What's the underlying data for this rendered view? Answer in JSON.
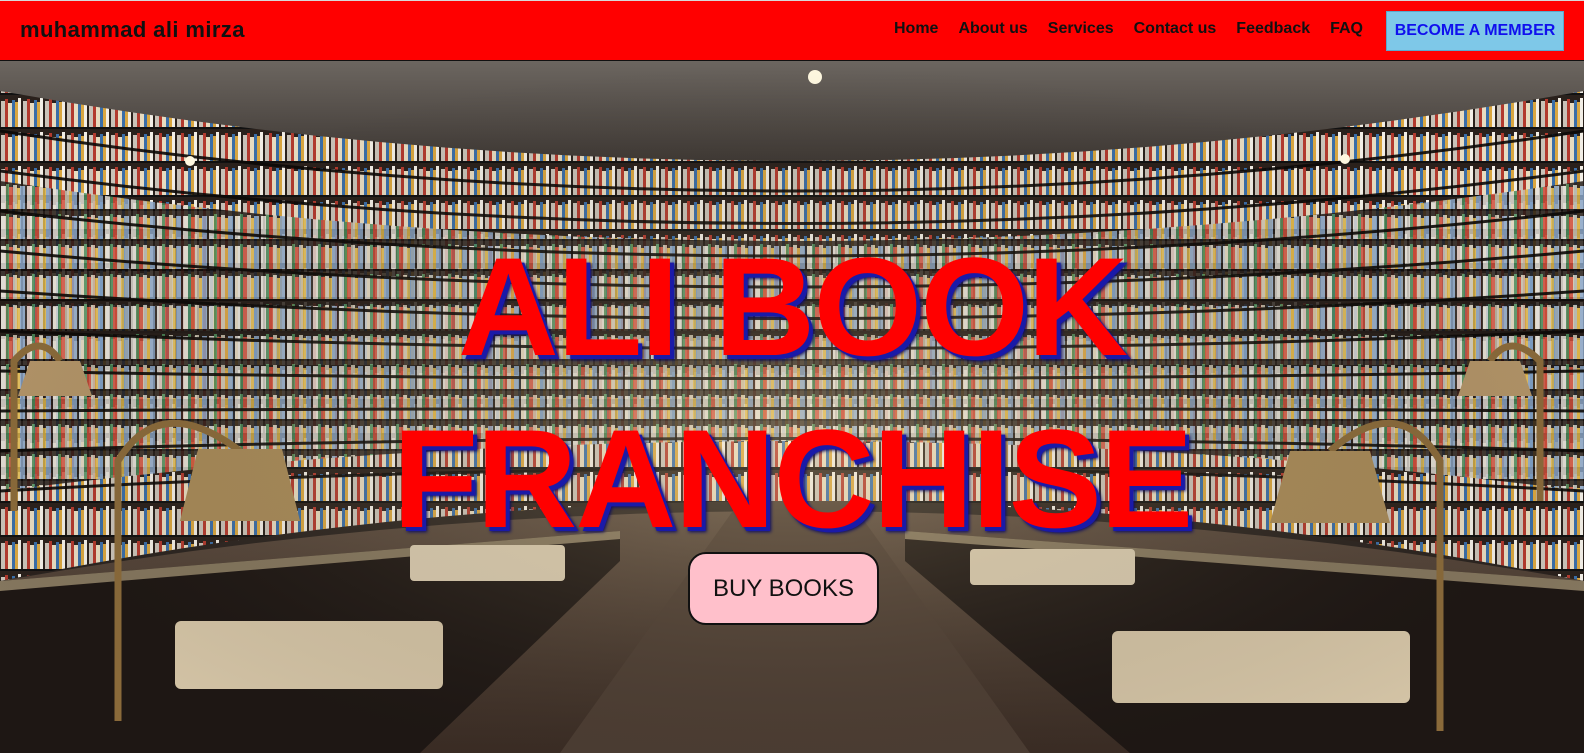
{
  "header": {
    "brand": "muhammad ali mirza",
    "nav": [
      {
        "label": "Home"
      },
      {
        "label": "About us"
      },
      {
        "label": "Services"
      },
      {
        "label": "Contact us"
      },
      {
        "label": "Feedback"
      },
      {
        "label": "FAQ"
      }
    ],
    "cta_label": "BECOME A MEMBER"
  },
  "hero": {
    "title_line1": "ALI BOOK",
    "title_line2": "FRANCHISE",
    "button_label": "BUY BOOKS"
  },
  "colors": {
    "navbar_bg": "#ff0000",
    "cta_bg": "#7ec8e8",
    "cta_text": "#1010ee",
    "headline": "#ff0000",
    "headline_shadow": "#1a1aa8",
    "buy_button_bg": "#ffc0cb"
  }
}
